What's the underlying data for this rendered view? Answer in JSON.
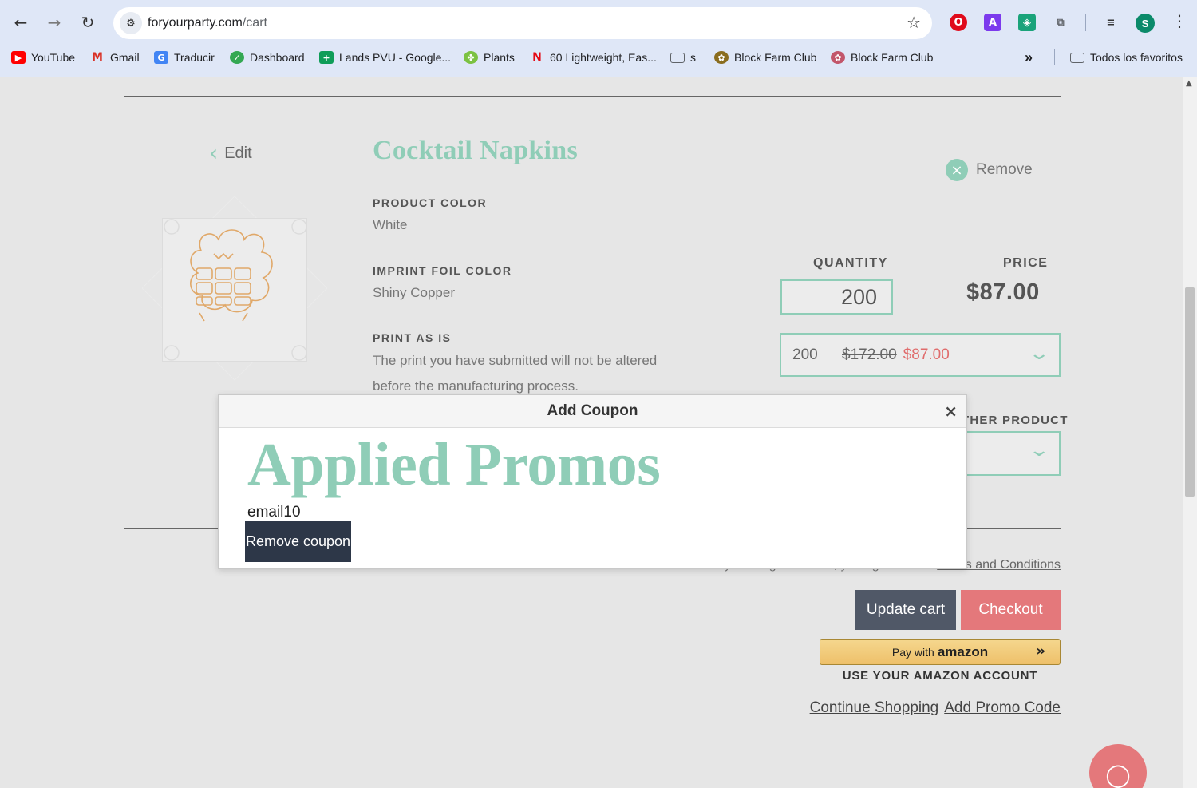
{
  "browser": {
    "url_host": "foryourparty.com",
    "url_path": "/cart",
    "extensions": [
      {
        "name": "opera-icon",
        "color": "#e00b1c",
        "glyph": "O"
      },
      {
        "name": "a-extension-icon",
        "color": "#7c3aed",
        "glyph": "A"
      },
      {
        "name": "shield-extension-icon",
        "color": "#1aa37a",
        "glyph": "◈"
      },
      {
        "name": "puzzle-icon",
        "color": "#5f6368",
        "glyph": "⧉"
      },
      {
        "name": "media-icon",
        "color": "#333333",
        "glyph": "≡"
      }
    ],
    "avatar_letter": "S",
    "bookmarks": [
      {
        "label": "YouTube",
        "icon": "youtube-icon",
        "color": "#ff0000",
        "glyph": "▶"
      },
      {
        "label": "Gmail",
        "icon": "gmail-icon",
        "color": "#d93025",
        "glyph": "M"
      },
      {
        "label": "Traducir",
        "icon": "translate-icon",
        "color": "#4285f4",
        "glyph": "G"
      },
      {
        "label": "Dashboard",
        "icon": "dashboard-icon",
        "color": "#34a853",
        "glyph": "✓"
      },
      {
        "label": "Lands PVU - Google...",
        "icon": "sheets-icon",
        "color": "#0f9d58",
        "glyph": "+"
      },
      {
        "label": "Plants",
        "icon": "plants-icon",
        "color": "#7cc242",
        "glyph": "✤"
      },
      {
        "label": "60 Lightweight, Eas...",
        "icon": "netflix-icon",
        "color": "#e50914",
        "glyph": "N"
      },
      {
        "label": "s",
        "icon": "folder-icon",
        "color": "#5f6368",
        "glyph": "▭"
      },
      {
        "label": "Block Farm Club",
        "icon": "blockfarm-icon",
        "color": "#8a6d1f",
        "glyph": "✿"
      },
      {
        "label": "Block Farm Club",
        "icon": "blockfarm2-icon",
        "color": "#c2566b",
        "glyph": "✿"
      }
    ],
    "more_bookmarks": "»",
    "all_bookmarks": "Todos los favoritos"
  },
  "cart": {
    "edit_label": "Edit",
    "product_title": "Cocktail Napkins",
    "options": [
      {
        "label": "PRODUCT COLOR",
        "value": "White"
      },
      {
        "label": "IMPRINT FOIL COLOR",
        "value": "Shiny Copper"
      }
    ],
    "print_label": "PRINT AS IS",
    "print_desc": "The print you have submitted will not be altered before the manufacturing process.",
    "remove_label": "Remove",
    "quantity_header": "QUANTITY",
    "price_header": "PRICE",
    "quantity_value": "200",
    "price_value": "$87.00",
    "select_qty": "200",
    "select_old_price": "$172.00",
    "select_new_price": "$87.00",
    "other_product_label": "THER PRODUCT",
    "terms_prefix": "By clicking Checkout, you agree to our ",
    "terms_link": "Terms and Conditions",
    "update_cart": "Update cart",
    "checkout": "Checkout",
    "amazon_pay_prefix": "Pay with",
    "amazon_brand": "amazon",
    "amazon_sub": "USE YOUR AMAZON ACCOUNT",
    "continue_shopping": "Continue Shopping",
    "add_promo": "Add Promo Code"
  },
  "modal": {
    "title": "Add Coupon",
    "close": "×",
    "heading": "Applied Promos",
    "coupon_code": "email10",
    "remove_coupon": "Remove coupon"
  },
  "colors": {
    "accent_mint": "#8fcdb7",
    "checkout_coral": "#e4787b",
    "update_slate": "#505867",
    "sale_red": "#e06c6c"
  }
}
